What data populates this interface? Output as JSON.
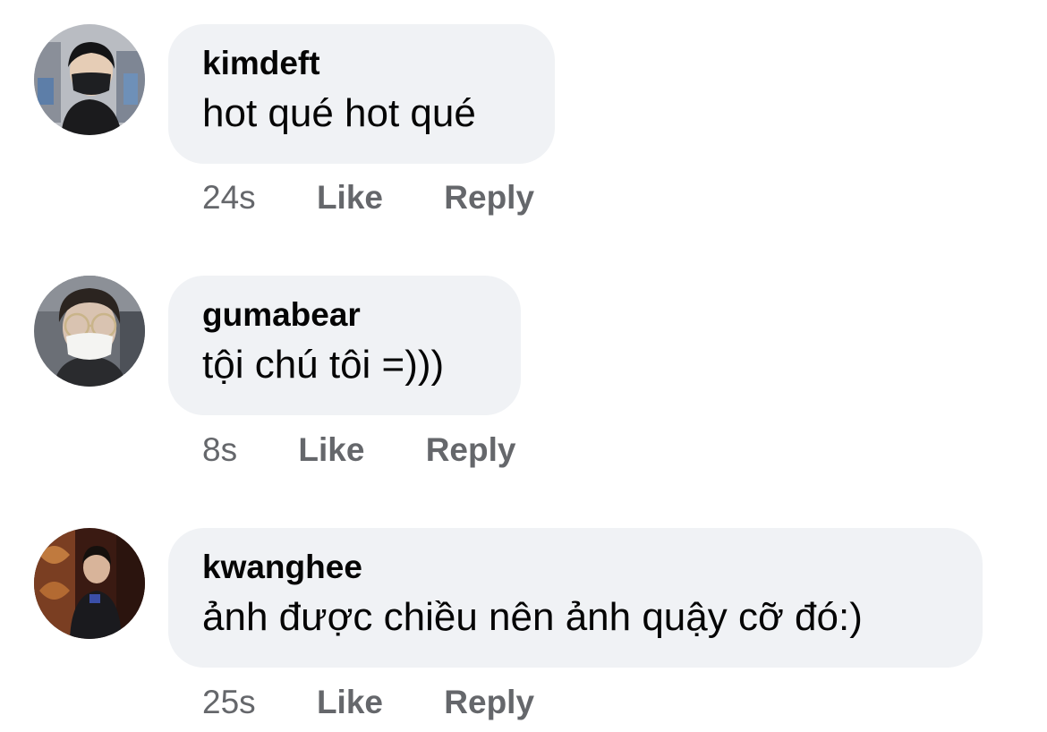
{
  "comments": [
    {
      "author": "kimdeft",
      "text": "hot qué hot qué",
      "time": "24s",
      "like_label": "Like",
      "reply_label": "Reply"
    },
    {
      "author": "gumabear",
      "text": "tội chú tôi =)))",
      "time": "8s",
      "like_label": "Like",
      "reply_label": "Reply"
    },
    {
      "author": "kwanghee",
      "text": "ảnh được chiều nên ảnh quậy cỡ đó:)",
      "time": "25s",
      "like_label": "Like",
      "reply_label": "Reply"
    }
  ],
  "colors": {
    "bubble_bg": "#f0f2f5",
    "text": "#050505",
    "meta": "#65676b"
  }
}
